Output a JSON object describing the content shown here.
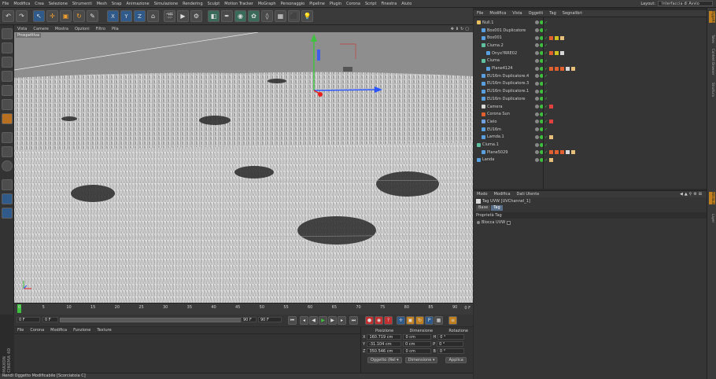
{
  "menubar": {
    "items": [
      "File",
      "Modifica",
      "Crea",
      "Selezione",
      "Strumenti",
      "Mesh",
      "Snap",
      "Animazione",
      "Simulazione",
      "Rendering",
      "Sculpt",
      "Motion Tracker",
      "MoGraph",
      "Personaggio",
      "Pipeline",
      "Plugin",
      "Corona",
      "Script",
      "Finestra",
      "Aiuto"
    ],
    "layout_label": "Layout:",
    "layout_value": "Interfaccia di Avvio"
  },
  "viewport": {
    "menu": [
      "Vista",
      "Camere",
      "Mostra",
      "Opzioni",
      "Filtro",
      "Pila"
    ],
    "label": "Prospettiva"
  },
  "timeline": {
    "ticks": [
      "0",
      "5",
      "10",
      "15",
      "20",
      "25",
      "30",
      "35",
      "40",
      "45",
      "50",
      "55",
      "60",
      "65",
      "70",
      "75",
      "80",
      "85",
      "90"
    ],
    "frame_right": "0 F"
  },
  "transport": {
    "current": "0 F",
    "start": "0 F",
    "end": "90 F",
    "end2": "90 F"
  },
  "materials": {
    "menu": [
      "File",
      "Corona",
      "Modifica",
      "Funzione",
      "Texture"
    ]
  },
  "coords": {
    "headers": [
      "Posizione",
      "Dimensione",
      "Rotazione"
    ],
    "rows": [
      {
        "axis": "X",
        "pos": "160.719 cm",
        "size": "0 cm",
        "rot_axis": "H",
        "rot": "0 °"
      },
      {
        "axis": "Y",
        "pos": "-31.104 cm",
        "size": "0 cm",
        "rot_axis": "P",
        "rot": "0 °"
      },
      {
        "axis": "Z",
        "pos": "350.546 cm",
        "size": "0 cm",
        "rot_axis": "B",
        "rot": "0 °"
      }
    ],
    "mode": "Oggetto (Rel ▾",
    "dim": "Dimensione ▾",
    "apply": "Applica"
  },
  "brand": "MAXON CINEMA 4D",
  "statusbar": "Rendi Oggetto Modificabile [Scorciatoia C]",
  "object_manager": {
    "menu": [
      "File",
      "Modifica",
      "Vista",
      "Oggetti",
      "Tag",
      "Segnalibri"
    ],
    "objects": [
      {
        "name": "Null.1",
        "indent": 0,
        "color": "#e8c060",
        "tags": []
      },
      {
        "name": "Box001 Duplicatore",
        "indent": 1,
        "color": "#5aa0e0",
        "tags": []
      },
      {
        "name": "Box001",
        "indent": 1,
        "color": "#5aa0e0",
        "tags": [
          "#e06030",
          "#d0c020",
          "#e6c07a"
        ]
      },
      {
        "name": "Ciuma.2",
        "indent": 1,
        "color": "#60c0a0",
        "tags": []
      },
      {
        "name": "Onyx?RRE02",
        "indent": 2,
        "color": "#5aa0e0",
        "tags": [
          "#e06030",
          "#d0c020",
          "#d8d8d8"
        ]
      },
      {
        "name": "Ciuma",
        "indent": 1,
        "color": "#60c0a0",
        "tags": []
      },
      {
        "name": "Plane4124",
        "indent": 2,
        "color": "#5aa0e0",
        "tags": [
          "#e06030",
          "#e06030",
          "#e06030",
          "#d8d8d8",
          "#e6c07a"
        ]
      },
      {
        "name": "EU16m Duplicatore.4",
        "indent": 1,
        "color": "#5aa0e0",
        "tags": []
      },
      {
        "name": "EU16m Duplicatore.3",
        "indent": 1,
        "color": "#5aa0e0",
        "tags": []
      },
      {
        "name": "EU16m Duplicatore.1",
        "indent": 1,
        "color": "#5aa0e0",
        "tags": []
      },
      {
        "name": "EU16m Duplicatore",
        "indent": 1,
        "color": "#5aa0e0",
        "tags": []
      },
      {
        "name": "Camera",
        "indent": 1,
        "color": "#d8d8d8",
        "tags": [
          "#e04040"
        ]
      },
      {
        "name": "Corona Sun",
        "indent": 1,
        "color": "#e06030",
        "tags": []
      },
      {
        "name": "Cielo",
        "indent": 1,
        "color": "#70a0e0",
        "tags": [
          "#e04040"
        ]
      },
      {
        "name": "EU16m",
        "indent": 1,
        "color": "#5aa0e0",
        "tags": []
      },
      {
        "name": "Lamda.1",
        "indent": 1,
        "color": "#5aa0e0",
        "tags": [
          "#e6c07a"
        ]
      },
      {
        "name": "Ciuma.1",
        "indent": 0,
        "color": "#60c0a0",
        "tags": []
      },
      {
        "name": "Plane5029",
        "indent": 1,
        "color": "#5aa0e0",
        "tags": [
          "#e06030",
          "#e06030",
          "#e06030",
          "#d8d8d8",
          "#e6c07a"
        ]
      },
      {
        "name": "Landa",
        "indent": 0,
        "color": "#5aa0e0",
        "tags": [
          "#e6c07a"
        ]
      }
    ]
  },
  "attributes": {
    "menu": [
      "Modo",
      "Modifica",
      "Dati Utente"
    ],
    "title": "Tag UVW [UVChannel_1]",
    "tabs": [
      "Base",
      "Tag"
    ],
    "section": "Proprietà Tag",
    "checkbox_label": "Blocca UVW"
  },
  "right_strip": [
    "Oggetti",
    "Takes",
    "Content Browser",
    "Struttura",
    "Attributi",
    "Layer"
  ]
}
